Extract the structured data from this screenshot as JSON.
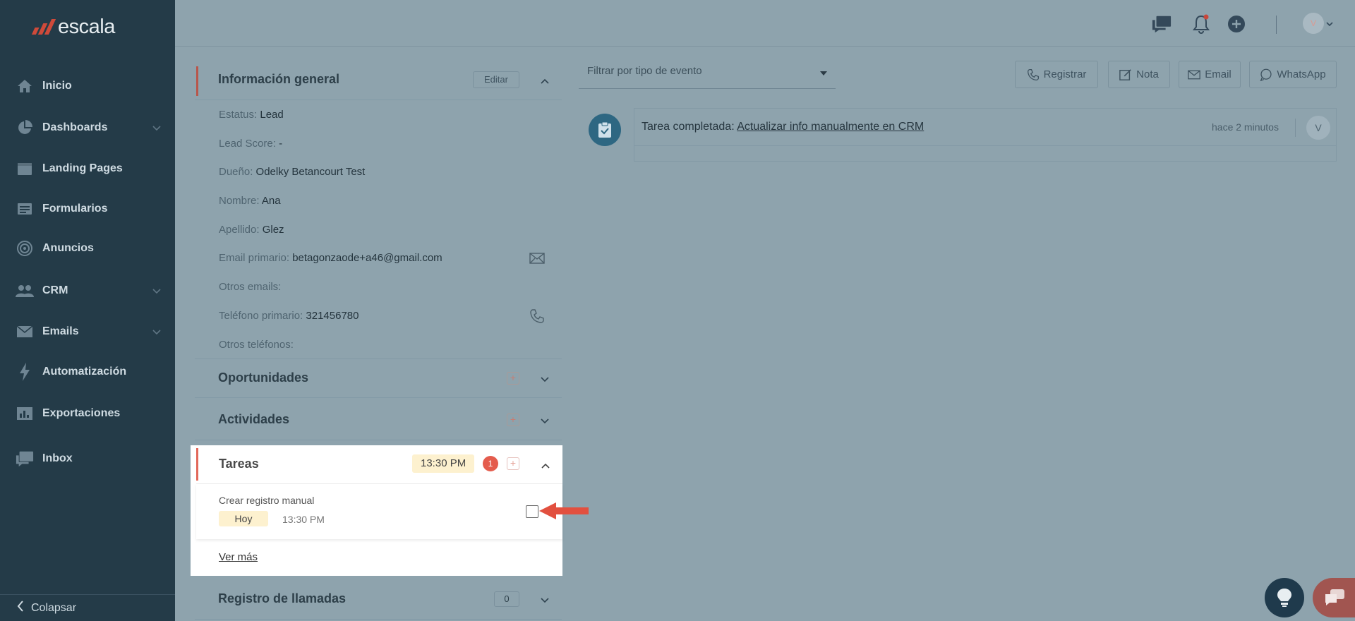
{
  "brand": {
    "name": "escala",
    "accent": "#cf4a3a"
  },
  "sidebar": {
    "items": [
      {
        "label": "Inicio",
        "icon": "home-icon"
      },
      {
        "label": "Dashboards",
        "icon": "pie-chart-icon"
      },
      {
        "label": "Landing Pages",
        "icon": "browser-icon"
      },
      {
        "label": "Formularios",
        "icon": "form-icon"
      },
      {
        "label": "Anuncios",
        "icon": "target-icon"
      },
      {
        "label": "CRM",
        "icon": "users-icon"
      },
      {
        "label": "Emails",
        "icon": "envelope-icon"
      },
      {
        "label": "Automatización",
        "icon": "bolt-icon"
      },
      {
        "label": "Exportaciones",
        "icon": "chart-icon"
      },
      {
        "label": "Inbox",
        "icon": "chat-icon"
      }
    ],
    "collapse_label": "Colapsar"
  },
  "topbar": {
    "avatar_initial": "V"
  },
  "general": {
    "title": "Información general",
    "edit_label": "Editar",
    "fields": [
      {
        "label": "Estatus:",
        "value": "Lead"
      },
      {
        "label": "Lead Score:",
        "value": "-"
      },
      {
        "label": "Dueño:",
        "value": "Odelky Betancourt Test"
      },
      {
        "label": "Nombre:",
        "value": "Ana"
      },
      {
        "label": "Apellido:",
        "value": "Glez"
      },
      {
        "label": "Email primario:",
        "value": "betagonzaode+a46@gmail.com"
      },
      {
        "label": "Otros emails:",
        "value": ""
      },
      {
        "label": "Teléfono primario:",
        "value": "321456780"
      },
      {
        "label": "Otros teléfonos:",
        "value": ""
      }
    ]
  },
  "sections": {
    "opportunities": "Oportunidades",
    "activities": "Actividades",
    "calls": {
      "title": "Registro de llamadas",
      "count": "0"
    }
  },
  "tasks": {
    "title": "Tareas",
    "time_badge": "13:30 PM",
    "count": "1",
    "item": {
      "name": "Crear registro manual",
      "day": "Hoy",
      "time": "13:30 PM"
    },
    "see_more": "Ver más"
  },
  "timeline": {
    "filter_placeholder": "Filtrar por tipo de evento",
    "actions": [
      "Registrar",
      "Nota",
      "Email",
      "WhatsApp"
    ],
    "event": {
      "prefix": "Tarea completada:",
      "link": "Actualizar info manualmente en CRM",
      "time": "hace 2 minutos",
      "avatar": "V"
    }
  }
}
